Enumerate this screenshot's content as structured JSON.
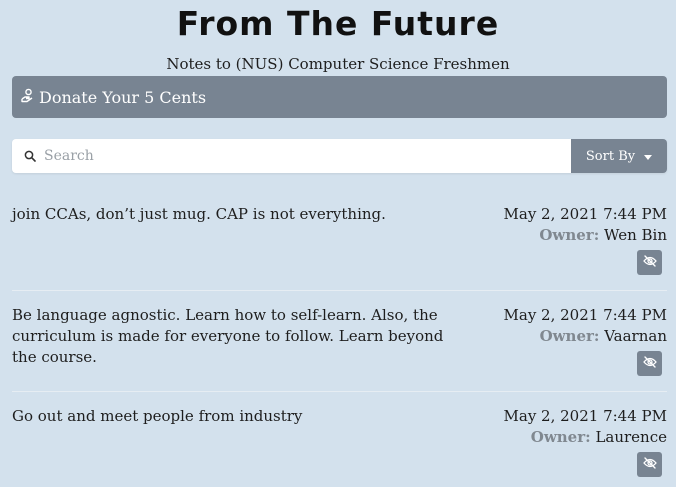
{
  "header": {
    "title": "From The Future",
    "subtitle": "Notes to (NUS) Computer Science Freshmen"
  },
  "donate": {
    "label": "Donate Your 5 Cents",
    "icon": "hand-coin-icon"
  },
  "search": {
    "placeholder": "Search",
    "value": "",
    "icon": "search-icon"
  },
  "sort": {
    "label": "Sort By",
    "icon": "caret-down-icon"
  },
  "owner_label": "Owner:",
  "notes": [
    {
      "text": "join CCAs, don’t just mug. CAP is not everything.",
      "date": "May 2, 2021 7:44 PM",
      "owner": "Wen Bin"
    },
    {
      "text": "Be language agnostic. Learn how to self-learn. Also, the curriculum is made for everyone to follow. Learn beyond the course.",
      "date": "May 2, 2021 7:44 PM",
      "owner": "Vaarnan"
    },
    {
      "text": "Go out and meet people from industry",
      "date": "May 2, 2021 7:44 PM",
      "owner": "Laurence"
    }
  ],
  "colors": {
    "background": "#d3e1ed",
    "button": "#788492",
    "owner_label": "#808890"
  }
}
